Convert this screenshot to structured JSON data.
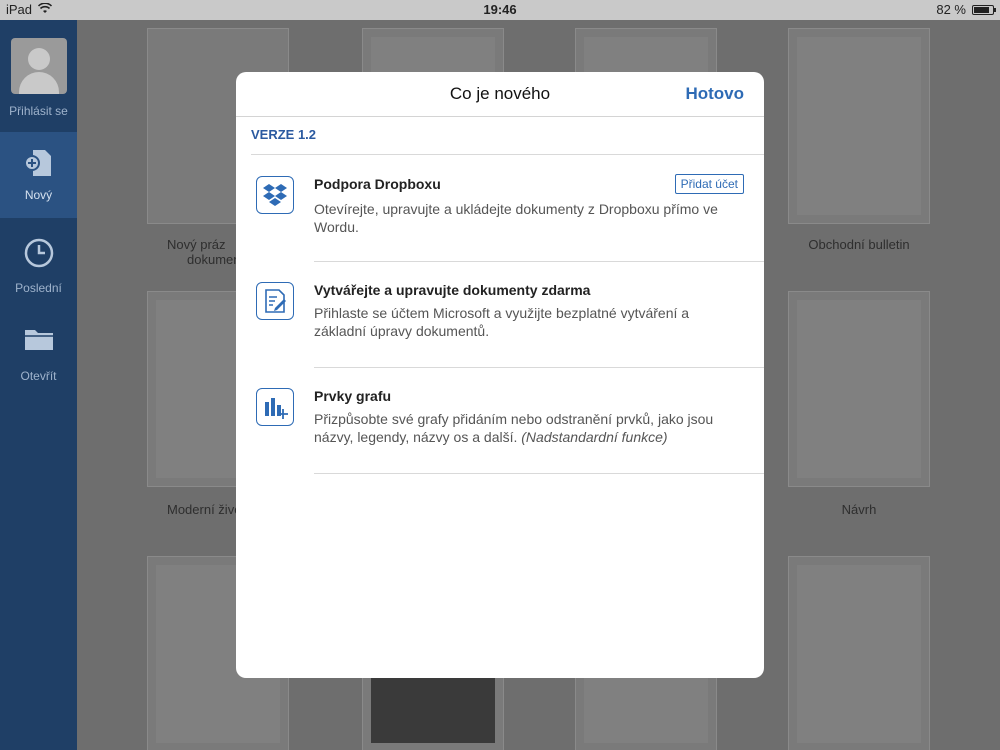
{
  "status": {
    "device": "iPad",
    "time": "19:46",
    "battery": "82 %"
  },
  "sidebar": {
    "signin": "Přihlásit se",
    "items": [
      {
        "label": "Nový",
        "icon": "new-doc-icon",
        "active": true
      },
      {
        "label": "Poslední",
        "icon": "clock-icon",
        "active": false
      },
      {
        "label": "Otevřít",
        "icon": "folder-icon",
        "active": false
      }
    ]
  },
  "templates": {
    "blank_1": "Nový práz",
    "blank_2": "dokumen",
    "bulletin": "Obchodní bulletin",
    "resume": "Moderní živo",
    "design": "Návrh"
  },
  "modal": {
    "title": "Co je nového",
    "done": "Hotovo",
    "version": "VERZE 1.2",
    "features": [
      {
        "title": "Podpora Dropboxu",
        "desc": "Otevírejte, upravujte a ukládejte dokumenty z Dropboxu přímo ve Wordu.",
        "action": "Přidat účet"
      },
      {
        "title": "Vytvářejte a upravujte dokumenty zdarma",
        "desc": "Přihlaste se účtem Microsoft a využijte bezplatné vytváření a základní úpravy dokumentů."
      },
      {
        "title": "Prvky grafu",
        "desc": "Přizpůsobte své grafy přidáním nebo odstranění prvků, jako jsou názvy, legendy, názvy os a další.",
        "desc_italic": "(Nadstandardní funkce)"
      }
    ]
  }
}
